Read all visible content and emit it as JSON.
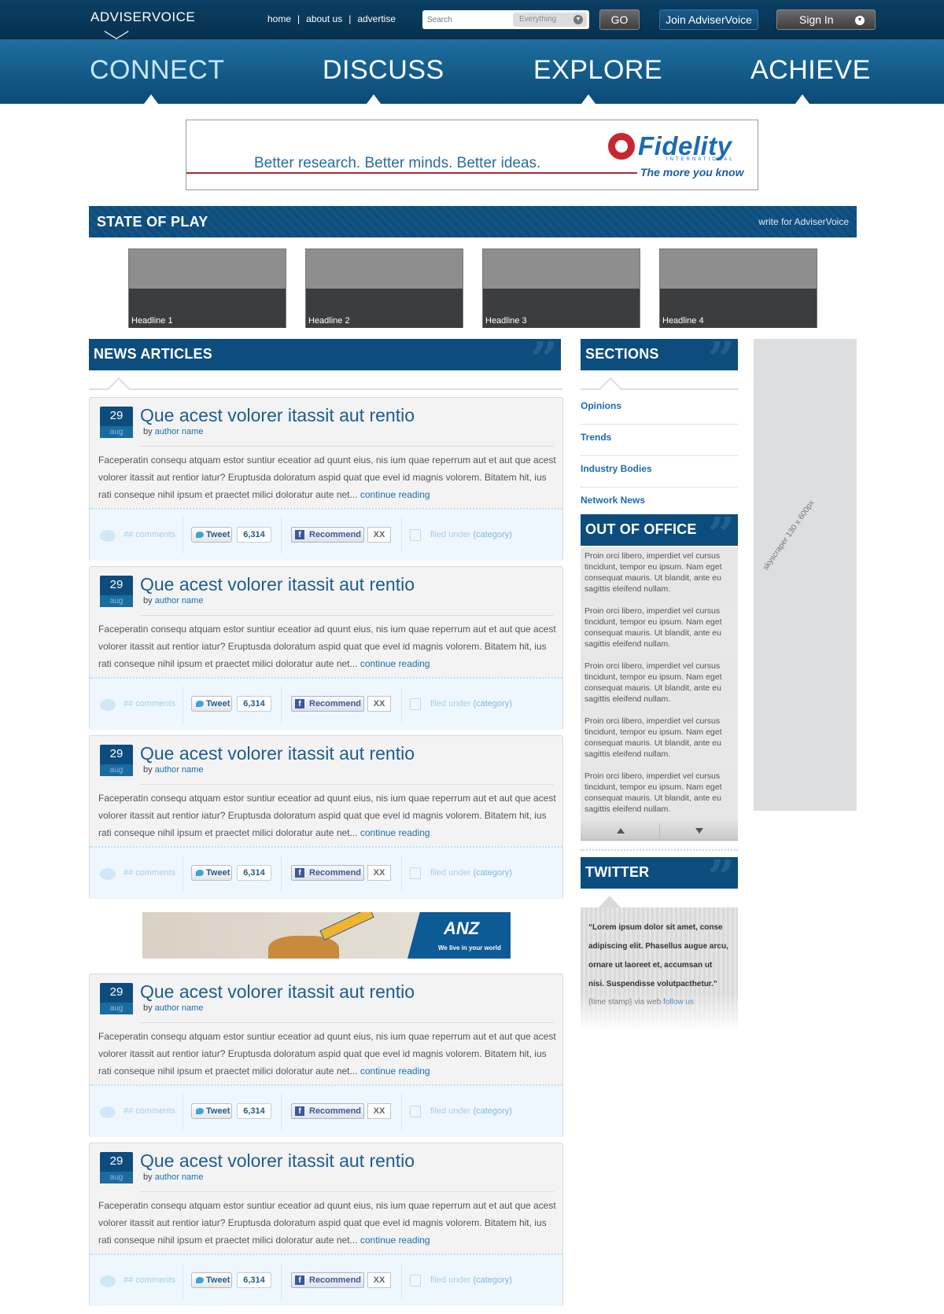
{
  "brand": {
    "name": "ADVISERVOICE"
  },
  "topnav": {
    "links": [
      "home",
      "about us",
      "advertise"
    ],
    "separator": "|"
  },
  "search": {
    "placeholder": "Search",
    "scope": "Everything",
    "go_label": "GO"
  },
  "account": {
    "join_label": "Join AdviserVoice",
    "signin_label": "Sign In"
  },
  "mainnav": [
    "CONNECT",
    "DISCUSS",
    "EXPLORE",
    "ACHIEVE"
  ],
  "banner_ad": {
    "tagline": "Better research. Better minds. Better ideas.",
    "brand": "Fidelity",
    "brand_sub": "INTERNATIONAL",
    "slogan": "The more you know"
  },
  "state_of_play": {
    "title": "STATE OF PLAY",
    "link": "write for AdviserVoice",
    "headlines": [
      "Headline 1",
      "Headline 2",
      "Headline 3",
      "Headline 4"
    ]
  },
  "news": {
    "title": "NEWS ARTICLES",
    "articles": [
      {
        "day": "29",
        "month": "aug",
        "title": "Que acest volorer itassit aut rentio",
        "by_prefix": "by",
        "author": "author name",
        "body": "Faceperatin consequ atquam estor suntiur eceatior ad quunt eius, nis ium quae reperrum aut et aut que acest volorer itassit aut rentior iatur? Eruptusda doloratum aspid quat que evel id magnis volorem. Bitatem hit, ius rati conseque nihil ipsum et praectet milici doloratur aute net...",
        "more": "continue reading",
        "comments": "## comments",
        "tweet": "Tweet",
        "tweet_count": "6,314",
        "recommend": "Recommend",
        "recommend_count": "XX",
        "filed_prefix": "filed under",
        "category": "(category)"
      },
      {
        "day": "29",
        "month": "aug",
        "title": "Que acest volorer itassit aut rentio",
        "by_prefix": "by",
        "author": "author name",
        "body": "Faceperatin consequ atquam estor suntiur eceatior ad quunt eius, nis ium quae reperrum aut et aut que acest volorer itassit aut rentior iatur? Eruptusda doloratum aspid quat que evel id magnis volorem. Bitatem hit, ius rati conseque nihil ipsum et praectet milici doloratur aute net...",
        "more": "continue reading",
        "comments": "## comments",
        "tweet": "Tweet",
        "tweet_count": "6,314",
        "recommend": "Recommend",
        "recommend_count": "XX",
        "filed_prefix": "filed under",
        "category": "(category)"
      },
      {
        "day": "29",
        "month": "aug",
        "title": "Que acest volorer itassit aut rentio",
        "by_prefix": "by",
        "author": "author name",
        "body": "Faceperatin consequ atquam estor suntiur eceatior ad quunt eius, nis ium quae reperrum aut et aut que acest volorer itassit aut rentior iatur? Eruptusda doloratum aspid quat que evel id magnis volorem. Bitatem hit, ius rati conseque nihil ipsum et praectet milici doloratur aute net...",
        "more": "continue reading",
        "comments": "## comments",
        "tweet": "Tweet",
        "tweet_count": "6,314",
        "recommend": "Recommend",
        "recommend_count": "XX",
        "filed_prefix": "filed under",
        "category": "(category)"
      },
      {
        "day": "29",
        "month": "aug",
        "title": "Que acest volorer itassit aut rentio",
        "by_prefix": "by",
        "author": "author name",
        "body": "Faceperatin consequ atquam estor suntiur eceatior ad quunt eius, nis ium quae reperrum aut et aut que acest volorer itassit aut rentior iatur? Eruptusda doloratum aspid quat que evel id magnis volorem. Bitatem hit, ius rati conseque nihil ipsum et praectet milici doloratur aute net...",
        "more": "continue reading",
        "comments": "## comments",
        "tweet": "Tweet",
        "tweet_count": "6,314",
        "recommend": "Recommend",
        "recommend_count": "XX",
        "filed_prefix": "filed under",
        "category": "(category)"
      },
      {
        "day": "29",
        "month": "aug",
        "title": "Que acest volorer itassit aut rentio",
        "by_prefix": "by",
        "author": "author name",
        "body": "Faceperatin consequ atquam estor suntiur eceatior ad quunt eius, nis ium quae reperrum aut et aut que acest volorer itassit aut rentior iatur? Eruptusda doloratum aspid quat que evel id magnis volorem. Bitatem hit, ius rati conseque nihil ipsum et praectet milici doloratur aute net...",
        "more": "continue reading",
        "comments": "## comments",
        "tweet": "Tweet",
        "tweet_count": "6,314",
        "recommend": "Recommend",
        "recommend_count": "XX",
        "filed_prefix": "filed under",
        "category": "(category)"
      }
    ]
  },
  "anz_ad": {
    "brand": "ANZ",
    "tagline": "We live in your world"
  },
  "sections": {
    "title": "SECTIONS",
    "items": [
      "Opinions",
      "Trends",
      "Industry Bodies",
      "Network News"
    ]
  },
  "out_of_office": {
    "title": "OUT OF OFFICE",
    "items": [
      "Proin orci libero, imperdiet vel cursus tincidunt, tempor eu ipsum. Nam eget consequat mauris. Ut blandit, ante eu sagittis eleifend nullam.",
      "Proin orci libero, imperdiet vel cursus tincidunt, tempor eu ipsum. Nam eget consequat mauris. Ut blandit, ante eu sagittis eleifend nullam.",
      "Proin orci libero, imperdiet vel cursus tincidunt, tempor eu ipsum. Nam eget consequat mauris. Ut blandit, ante eu sagittis eleifend nullam.",
      "Proin orci libero, imperdiet vel cursus tincidunt, tempor eu ipsum. Nam eget consequat mauris. Ut blandit, ante eu sagittis eleifend nullam.",
      "Proin orci libero, imperdiet vel cursus tincidunt, tempor eu ipsum. Nam eget consequat mauris. Ut blandit, ante eu sagittis eleifend nullam."
    ]
  },
  "twitter": {
    "title": "TWITTER",
    "tweet": "“Lorem ipsum dolor sit amet, conse adipiscing elit. Phasellus augue arcu, ornare ut laoreet et, accumsan ut nisi. Suspendisse volutpacthetur.”",
    "meta": "{time stamp} via web",
    "follow": "follow us"
  },
  "skyscraper": {
    "label": "skyscraper 130 x 600px"
  },
  "colors": {
    "brand_blue": "#0d4d7e",
    "nav_blue": "#1e6f9f",
    "link_blue": "#1a6fae"
  }
}
